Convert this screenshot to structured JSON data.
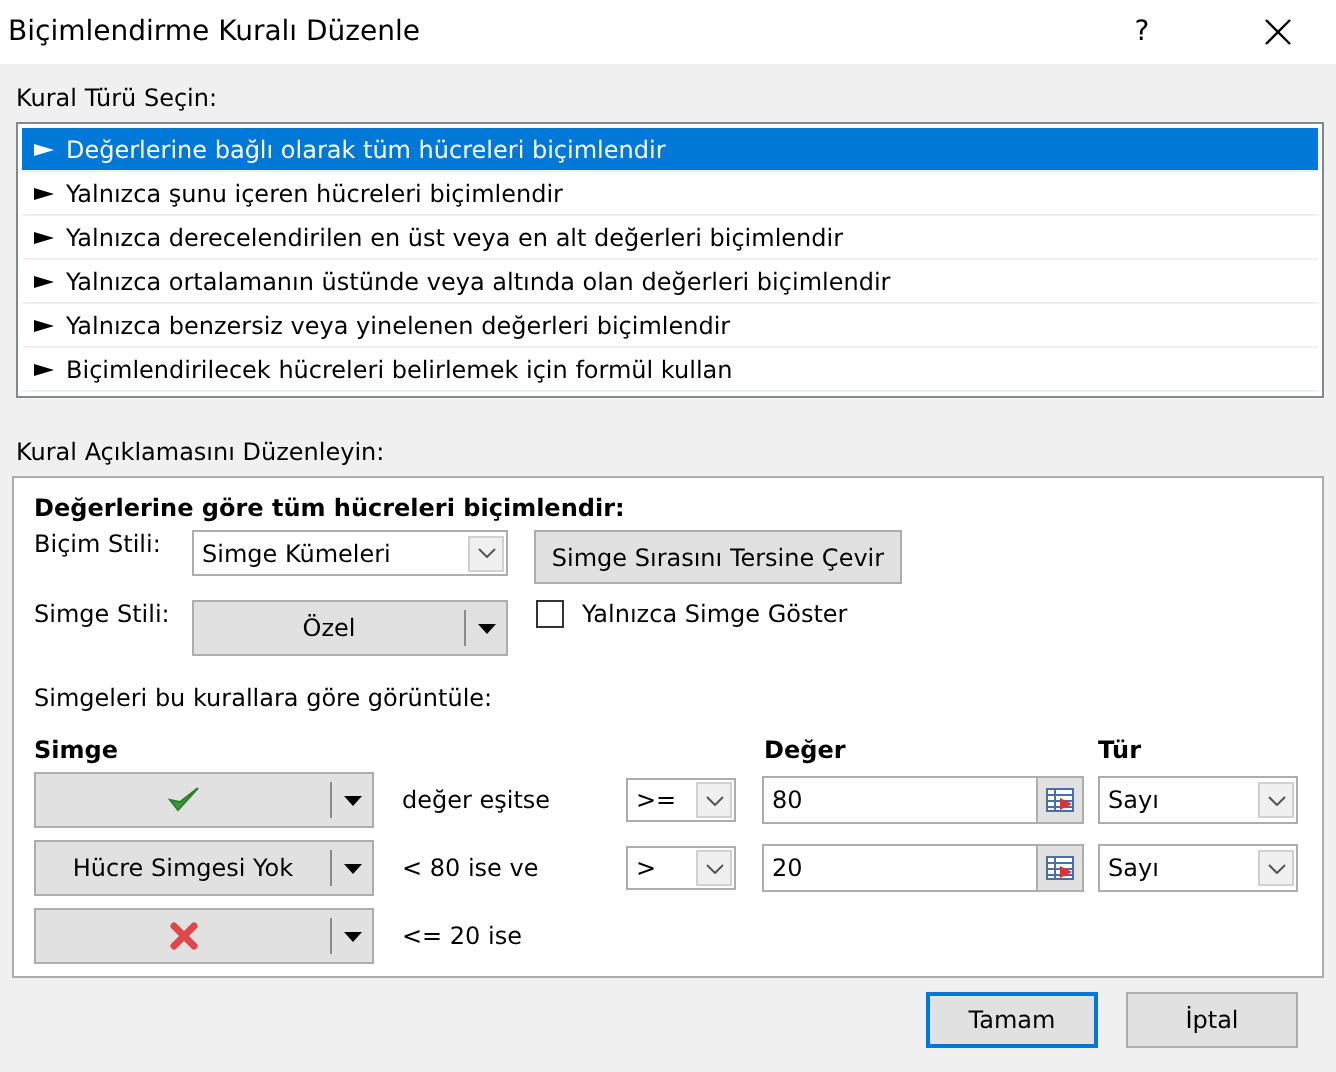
{
  "window": {
    "title": "Biçimlendirme Kuralı Düzenle",
    "help": "?"
  },
  "rule_type": {
    "label": "Kural Türü Seçin:",
    "items": [
      {
        "label": "Değerlerine bağlı olarak tüm hücreleri biçimlendir",
        "selected": true
      },
      {
        "label": "Yalnızca şunu içeren hücreleri biçimlendir",
        "selected": false
      },
      {
        "label": "Yalnızca derecelendirilen en üst veya en alt değerleri biçimlendir",
        "selected": false
      },
      {
        "label": "Yalnızca ortalamanın üstünde veya altında olan değerleri biçimlendir",
        "selected": false
      },
      {
        "label": "Yalnızca benzersiz veya yinelenen değerleri biçimlendir",
        "selected": false
      },
      {
        "label": "Biçimlendirilecek hücreleri belirlemek için formül kullan",
        "selected": false
      }
    ]
  },
  "description": {
    "label": "Kural Açıklamasını Düzenleyin:",
    "heading": "Değerlerine göre tüm hücreleri biçimlendir:",
    "format_style": {
      "label": "Biçim Stili:",
      "value": "Simge Kümeleri"
    },
    "reverse_button": "Simge Sırasını Tersine Çevir",
    "icon_style": {
      "label": "Simge Stili:",
      "value": "Özel"
    },
    "icon_only": {
      "label": "Yalnızca Simge Göster",
      "checked": false
    },
    "rules_label": "Simgeleri bu kurallara göre görüntüle:",
    "columns": [
      "Simge",
      "Değer",
      "Tür"
    ],
    "rows": [
      {
        "icon": {
          "kind": "check"
        },
        "condition": "değer eşitse",
        "operator": ">=",
        "value": "80",
        "type": "Sayı"
      },
      {
        "icon": {
          "kind": "text",
          "label": "Hücre Simgesi Yok"
        },
        "condition": "< 80 ise ve",
        "operator": ">",
        "value": "20",
        "type": "Sayı"
      },
      {
        "icon": {
          "kind": "cross"
        },
        "condition": "<= 20 ise"
      }
    ]
  },
  "buttons": [
    {
      "label": "Tamam",
      "default": true
    },
    {
      "label": "İptal",
      "default": false
    }
  ]
}
